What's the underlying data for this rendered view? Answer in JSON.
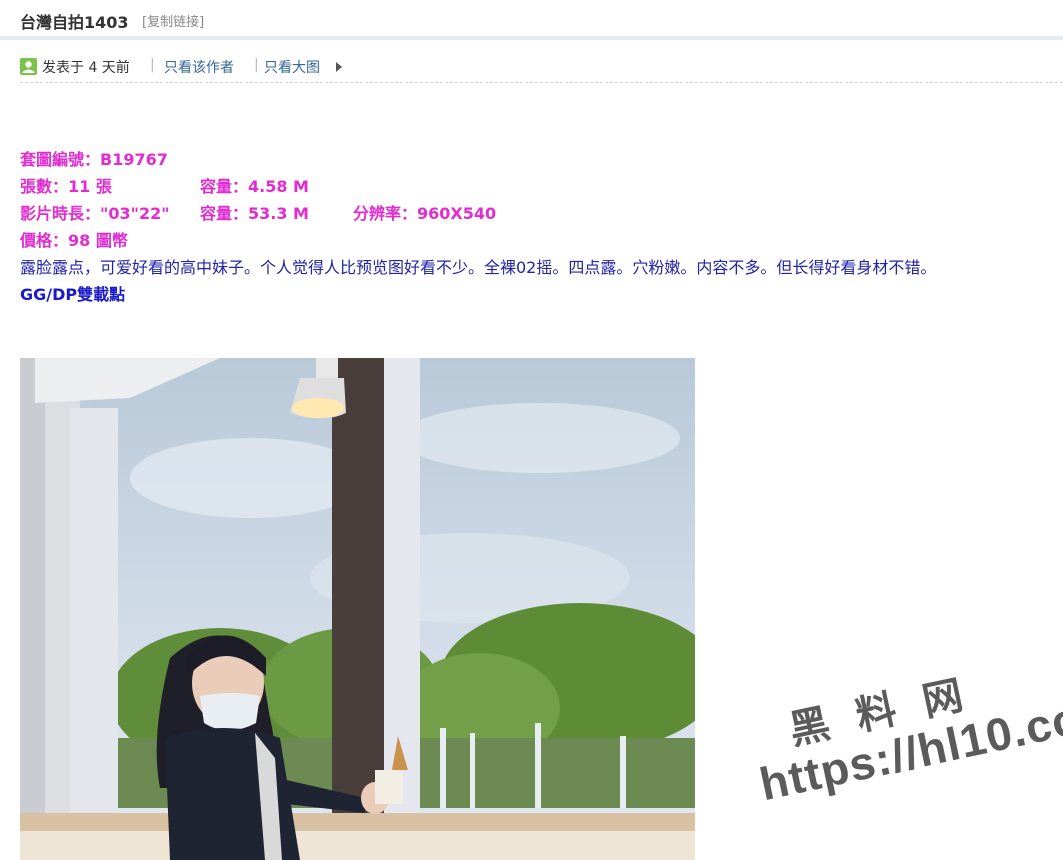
{
  "header": {
    "title": "台灣自拍1403",
    "copy_link": "[复制链接]"
  },
  "meta": {
    "posted": "发表于 4 天前",
    "sep": "|",
    "only_author": "只看该作者",
    "only_image": "只看大图",
    "icons": {
      "user": "user-icon",
      "arrow": "triangle-right-icon"
    }
  },
  "info": {
    "set_id": "套圖編號：B19767",
    "count": "張數：11 張",
    "size1": "容量：4.58 M",
    "duration": "影片時長：\"03\"22\"",
    "size2": "容量：53.3 M",
    "resolution": "分辨率：960X540",
    "price": "價格：98 圖幣",
    "description": "露脸露点，可爱好看的高中妹子。个人觉得人比预览图好看不少。全裸02摇。四点露。穴粉嫩。内容不多。但长得好看身材不错。",
    "download": "GG/DP雙載點"
  },
  "watermark": {
    "cn": "黑料网",
    "url": "https://hl10.co"
  },
  "colors": {
    "magenta": "#e22bd0",
    "blue_text": "#2222aa",
    "link": "#336699"
  }
}
